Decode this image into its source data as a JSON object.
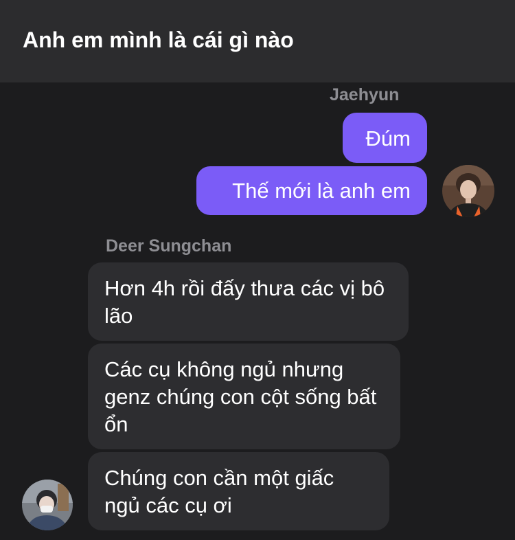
{
  "header": {
    "title": "Anh em mình là cái gì nào"
  },
  "outgoing_group": {
    "sender": "Jaehyun",
    "messages": [
      "Đúm",
      "Thế mới là anh em"
    ],
    "avatar_icon": "user-avatar-photo"
  },
  "incoming_group": {
    "sender": "Deer Sungchan",
    "messages": [
      "Hơn 4h rồi đấy thưa các vị bô lão",
      "Các cụ không ngủ nhưng genz chúng con cột sống bất ổn",
      "Chúng con cần một giấc ngủ các cụ ơi"
    ],
    "avatar_icon": "user-avatar-photo"
  },
  "colors": {
    "background": "#1c1c1e",
    "header": "#2c2c2e",
    "outgoing_bubble": "#7b5cf7",
    "incoming_bubble": "#2d2d30",
    "sender_name": "#8e8e93"
  }
}
